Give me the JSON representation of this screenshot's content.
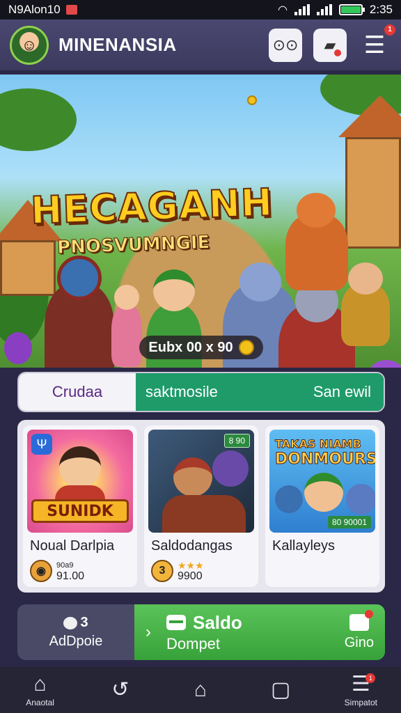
{
  "status_bar": {
    "time_left": "N9Alon10",
    "time_right": "2:35"
  },
  "header": {
    "app_title": "MINENANSIA",
    "notif_count": "1"
  },
  "hero": {
    "title": "HECAGANH",
    "subtitle": "PNOSVUMNGIE",
    "pill_text": "Eubx 00 x 90"
  },
  "tabs": [
    {
      "label": "Crudaa"
    },
    {
      "label": "saktmosile"
    },
    {
      "label": "San ewil"
    }
  ],
  "games": [
    {
      "thumb_text": "SUNIDK",
      "title": "Noual Darlpia",
      "meta_top": "90a9",
      "meta_price": "91.00",
      "meta_icon": ""
    },
    {
      "thumb_badge": "8 90",
      "title": "Saldodangas",
      "meta_icon": "3",
      "stars": "★★★",
      "meta_price": "9900"
    },
    {
      "thumb_title_line1": "TAKAS NIAMB",
      "thumb_title_line2": "DONMOURS",
      "thumb_badge": "80 90001",
      "title": "Kallayleys"
    }
  ],
  "action_bar": {
    "left_toggle_value": "3",
    "left_label": "AdDpoie",
    "main_top": "Saldo",
    "main_bottom": "Dompet",
    "right_label": "Gino"
  },
  "bottom_nav": [
    {
      "label": "Anaotal",
      "icon": "home-icon"
    },
    {
      "label": "",
      "icon": "back-icon"
    },
    {
      "label": "",
      "icon": "home-outline-icon"
    },
    {
      "label": "",
      "icon": "chat-icon"
    },
    {
      "label": "Simpatot",
      "icon": "menu-icon",
      "badge": "1"
    }
  ],
  "colors": {
    "accent_green": "#1f9b6a",
    "action_green": "#38a23a",
    "header_purple": "#4a4870",
    "badge_red": "#e53935"
  }
}
